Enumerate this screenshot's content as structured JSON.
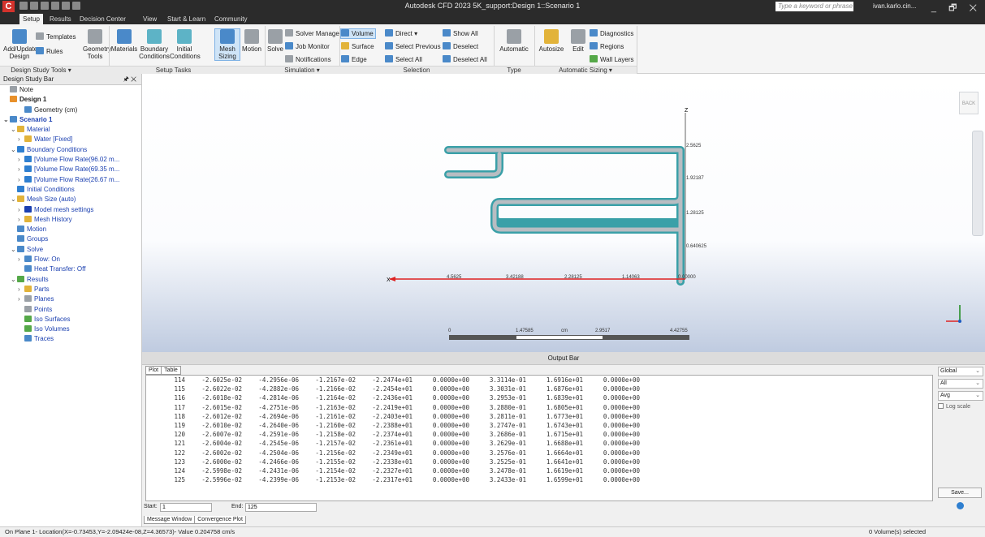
{
  "titlebar": {
    "app_letter": "C",
    "title": "Autodesk CFD 2023  5K_support:Design 1::Scenario 1",
    "search_placeholder": "Type a keyword or phrase",
    "user": "ivan.karlo.cin...",
    "window_controls": "_ 🗗 ✕"
  },
  "menu_tabs": [
    "Setup",
    "Results",
    "Decision Center",
    "View",
    "Start & Learn",
    "Community"
  ],
  "ribbon": {
    "add_update": "Add/Update\nDesign",
    "templates": "Templates",
    "rules": "Rules",
    "geometry_tools": "Geometry\nTools",
    "materials": "Materials",
    "boundary_conditions": "Boundary\nConditions",
    "initial_conditions": "Initial\nConditions",
    "mesh_sizing": "Mesh\nSizing",
    "motion": "Motion",
    "solve": "Solve",
    "solver_manager": "Solver Manager",
    "job_monitor": "Job Monitor",
    "notifications": "Notifications",
    "volume": "Volume",
    "surface": "Surface",
    "edge": "Edge",
    "direct": "Direct",
    "select_previous": "Select Previous",
    "select_all": "Select All",
    "show_all": "Show All",
    "deselect": "Deselect",
    "deselect_all": "Deselect All",
    "automatic": "Automatic",
    "autosize": "Autosize",
    "edit": "Edit",
    "diagnostics": "Diagnostics",
    "regions": "Regions",
    "wall_layers": "Wall Layers",
    "groups": {
      "design_study_tools": "Design Study Tools ▾",
      "setup_tasks": "Setup Tasks",
      "simulation": "Simulation ▾",
      "selection": "Selection",
      "type": "Type",
      "automatic_sizing": "Automatic Sizing ▾"
    }
  },
  "design_study_bar": {
    "header": "Design Study Bar",
    "pin": "🖈 ✕",
    "tree": [
      {
        "label": "Note",
        "icon": "note-icon"
      },
      {
        "label": "Design 1",
        "icon": "design-icon"
      },
      {
        "label": "Geometry (cm)",
        "icon": "geometry-icon"
      },
      {
        "label": "Scenario 1",
        "icon": "scenario-icon"
      },
      {
        "label": "Material",
        "icon": "material-icon"
      },
      {
        "label": "Water [Fixed]",
        "icon": "material-icon"
      },
      {
        "label": "Boundary Conditions",
        "icon": "boundary-icon"
      },
      {
        "label": "[Volume Flow Rate(96.02 m...",
        "icon": "boundary-icon"
      },
      {
        "label": "[Volume Flow Rate(69.35 m...",
        "icon": "boundary-icon"
      },
      {
        "label": "[Volume Flow Rate(26.67 m...",
        "icon": "boundary-icon"
      },
      {
        "label": "Initial Conditions",
        "icon": "initial-icon"
      },
      {
        "label": "Mesh Size (auto)",
        "icon": "mesh-icon"
      },
      {
        "label": "Model mesh settings",
        "icon": "info-icon"
      },
      {
        "label": "Mesh History",
        "icon": "mesh-icon"
      },
      {
        "label": "Motion",
        "icon": "motion-icon"
      },
      {
        "label": "Groups",
        "icon": "groups-icon"
      },
      {
        "label": "Solve",
        "icon": "solve-icon"
      },
      {
        "label": "Flow: On",
        "icon": "flow-icon"
      },
      {
        "label": "Heat Transfer: Off",
        "icon": "flow-icon"
      },
      {
        "label": "Results",
        "icon": "results-icon"
      },
      {
        "label": "Parts",
        "icon": "parts-icon"
      },
      {
        "label": "Planes",
        "icon": "planes-icon"
      },
      {
        "label": "Points",
        "icon": "points-icon"
      },
      {
        "label": "Iso Surfaces",
        "icon": "iso-icon"
      },
      {
        "label": "Iso Volumes",
        "icon": "iso-icon"
      },
      {
        "label": "Traces",
        "icon": "traces-icon"
      }
    ]
  },
  "viewport": {
    "back_label": "BACK",
    "z_axis": "Z",
    "x_axis": "X",
    "z_ticks": [
      "2.5625",
      "1.92187",
      "1.28125",
      "0.640625"
    ],
    "x_ticks": [
      "4.5625",
      "3.42188",
      "2.28125",
      "1.14063",
      "0.00000"
    ],
    "scale_labels": [
      "0",
      "1.47585",
      "cm",
      "2.9517",
      "4.42755"
    ]
  },
  "output_bar": {
    "header": "Output Bar",
    "tabs": [
      "Plot",
      "Table"
    ],
    "rows": [
      [
        "114",
        "-2.6025e-02",
        "-4.2956e-06",
        "-1.2167e-02",
        "-2.2474e+01",
        "0.0000e+00",
        "3.3114e-01",
        "1.6916e+01",
        "0.0000e+00"
      ],
      [
        "115",
        "-2.6022e-02",
        "-4.2882e-06",
        "-1.2166e-02",
        "-2.2454e+01",
        "0.0000e+00",
        "3.3031e-01",
        "1.6876e+01",
        "0.0000e+00"
      ],
      [
        "116",
        "-2.6018e-02",
        "-4.2814e-06",
        "-1.2164e-02",
        "-2.2436e+01",
        "0.0000e+00",
        "3.2953e-01",
        "1.6839e+01",
        "0.0000e+00"
      ],
      [
        "117",
        "-2.6015e-02",
        "-4.2751e-06",
        "-1.2163e-02",
        "-2.2419e+01",
        "0.0000e+00",
        "3.2880e-01",
        "1.6805e+01",
        "0.0000e+00"
      ],
      [
        "118",
        "-2.6012e-02",
        "-4.2694e-06",
        "-1.2161e-02",
        "-2.2403e+01",
        "0.0000e+00",
        "3.2811e-01",
        "1.6773e+01",
        "0.0000e+00"
      ],
      [
        "119",
        "-2.6010e-02",
        "-4.2640e-06",
        "-1.2160e-02",
        "-2.2388e+01",
        "0.0000e+00",
        "3.2747e-01",
        "1.6743e+01",
        "0.0000e+00"
      ],
      [
        "120",
        "-2.6007e-02",
        "-4.2591e-06",
        "-1.2158e-02",
        "-2.2374e+01",
        "0.0000e+00",
        "3.2686e-01",
        "1.6715e+01",
        "0.0000e+00"
      ],
      [
        "121",
        "-2.6004e-02",
        "-4.2545e-06",
        "-1.2157e-02",
        "-2.2361e+01",
        "0.0000e+00",
        "3.2629e-01",
        "1.6688e+01",
        "0.0000e+00"
      ],
      [
        "122",
        "-2.6002e-02",
        "-4.2504e-06",
        "-1.2156e-02",
        "-2.2349e+01",
        "0.0000e+00",
        "3.2576e-01",
        "1.6664e+01",
        "0.0000e+00"
      ],
      [
        "123",
        "-2.6000e-02",
        "-4.2466e-06",
        "-1.2155e-02",
        "-2.2338e+01",
        "0.0000e+00",
        "3.2525e-01",
        "1.6641e+01",
        "0.0000e+00"
      ],
      [
        "124",
        "-2.5998e-02",
        "-4.2431e-06",
        "-1.2154e-02",
        "-2.2327e+01",
        "0.0000e+00",
        "3.2478e-01",
        "1.6619e+01",
        "0.0000e+00"
      ],
      [
        "125",
        "-2.5996e-02",
        "-4.2399e-06",
        "-1.2153e-02",
        "-2.2317e+01",
        "0.0000e+00",
        "3.2433e-01",
        "1.6599e+01",
        "0.0000e+00"
      ]
    ],
    "global": "Global",
    "all": "All",
    "avg": "Avg",
    "log_scale": "Log scale",
    "save": "Save...",
    "start_label": "Start:",
    "start_value": "1",
    "end_label": "End:",
    "end_value": "125",
    "bottom_tabs": [
      "Message Window",
      "Convergence Plot"
    ]
  },
  "status": {
    "left": "On Plane 1- Location(X=-0.73453,Y=-2.09424e-08,Z=4.36573)- Value  0.204758  cm/s",
    "right": "0 Volume(s) selected"
  }
}
